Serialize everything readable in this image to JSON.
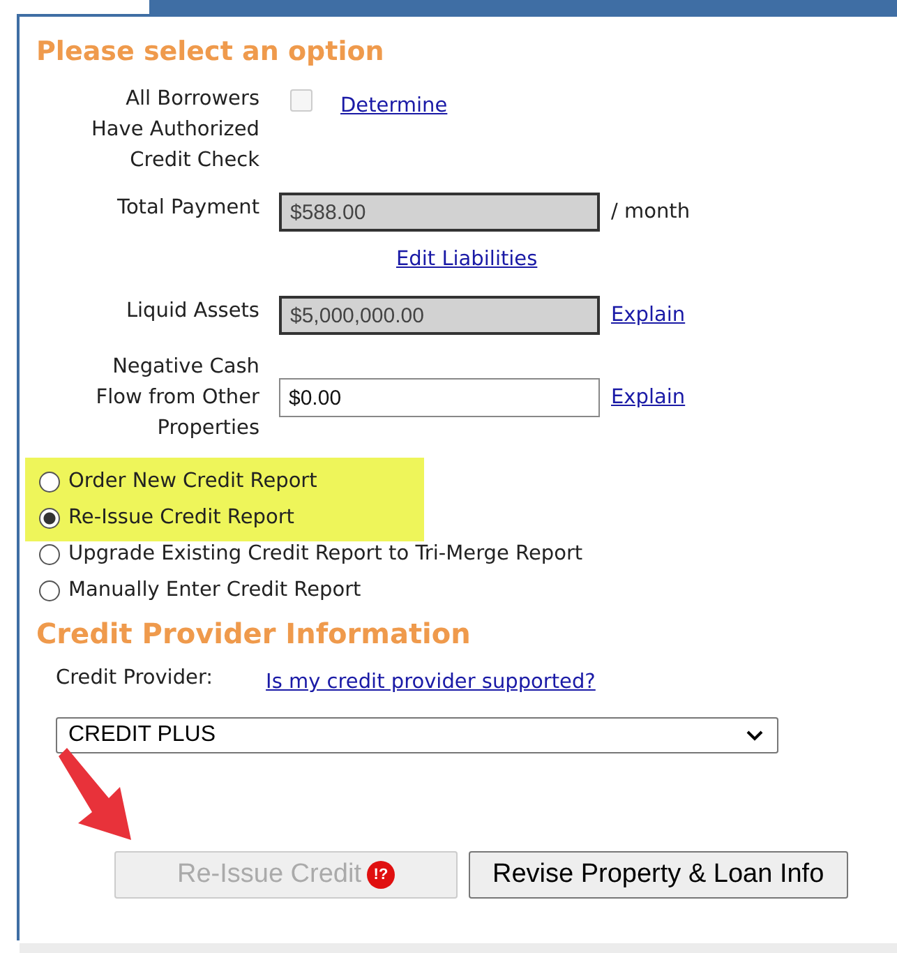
{
  "title": "Please select an option",
  "authorization": {
    "label": "All Borrowers Have Authorized Credit Check",
    "checked": false,
    "link": "Determine"
  },
  "total_payment": {
    "label": "Total Payment",
    "value": "$588.00",
    "disabled": true,
    "suffix": "/ month",
    "link": "Edit Liabilities"
  },
  "liquid_assets": {
    "label": "Liquid Assets",
    "value": "$5,000,000.00",
    "disabled": true,
    "link": "Explain"
  },
  "negative_cash": {
    "label": "Negative Cash Flow from Other Properties",
    "value": "$0.00",
    "disabled": false,
    "link": "Explain"
  },
  "options": [
    {
      "label": "Order New Credit Report",
      "selected": false,
      "highlighted": true
    },
    {
      "label": "Re-Issue Credit Report",
      "selected": true,
      "highlighted": true
    },
    {
      "label": "Upgrade Existing Credit Report to Tri-Merge Report",
      "selected": false,
      "highlighted": false
    },
    {
      "label": "Manually Enter Credit Report",
      "selected": false,
      "highlighted": false
    }
  ],
  "provider_heading": "Credit Provider Information",
  "provider": {
    "label": "Credit Provider:",
    "link": "Is my credit provider supported?",
    "value": "CREDIT PLUS"
  },
  "buttons": [
    {
      "label": "Re-Issue Credit",
      "disabled": true,
      "badge": "!?",
      "pointed": true
    },
    {
      "label": "Revise Property & Loan Info",
      "disabled": false,
      "pointed": false
    }
  ]
}
